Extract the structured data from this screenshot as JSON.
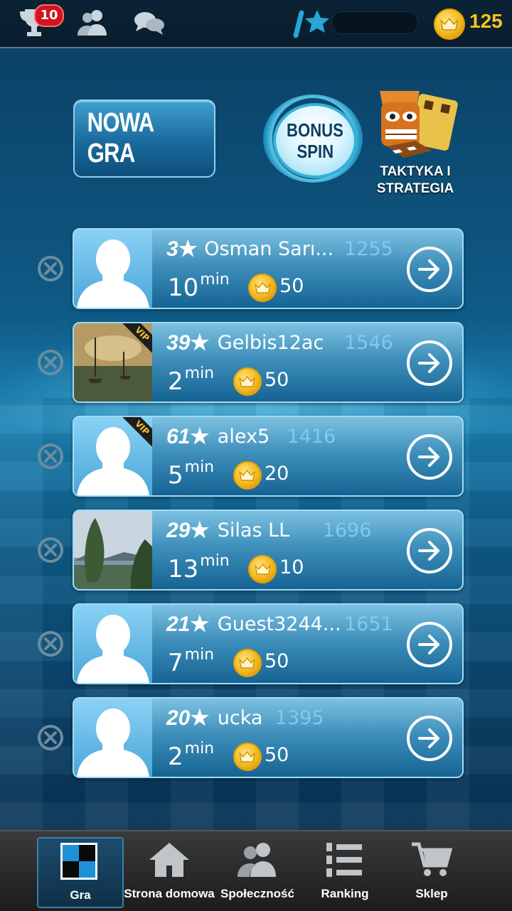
{
  "topbar": {
    "trophy_badge": "10",
    "coins": "125"
  },
  "actions": {
    "new_game": "NOWA GRA",
    "bonus_line1": "BONUS",
    "bonus_line2": "SPIN",
    "tactic_line1": "TAKTYKA I",
    "tactic_line2": "STRATEGIA"
  },
  "games": [
    {
      "level": "3",
      "name": "Osman Sarı...",
      "rating": "1255",
      "time": "10",
      "unit": "min",
      "stake": "50",
      "avatar": "silhouette",
      "vip": false
    },
    {
      "level": "39",
      "name": "Gelbis12ac",
      "rating": "1546",
      "time": "2",
      "unit": "min",
      "stake": "50",
      "avatar": "painting",
      "vip": true
    },
    {
      "level": "61",
      "name": "alex5",
      "rating": "1416",
      "time": "5",
      "unit": "min",
      "stake": "20",
      "avatar": "silhouette",
      "vip": true
    },
    {
      "level": "29",
      "name": "Silas LL",
      "rating": "1696",
      "time": "13",
      "unit": "min",
      "stake": "10",
      "avatar": "landscape",
      "vip": false
    },
    {
      "level": "21",
      "name": "Guest3244...",
      "rating": "1651",
      "time": "7",
      "unit": "min",
      "stake": "50",
      "avatar": "silhouette",
      "vip": false
    },
    {
      "level": "20",
      "name": "ucka",
      "rating": "1395",
      "time": "2",
      "unit": "min",
      "stake": "50",
      "avatar": "silhouette",
      "vip": false
    }
  ],
  "vip_label": "VIP",
  "nav": {
    "game": "Gra",
    "home": "Strona domowa",
    "community": "Społeczność",
    "ranking": "Ranking",
    "shop": "Sklep"
  },
  "colors": {
    "accent": "#2a86b8",
    "coin": "#f3b81d",
    "badge": "#d2141e",
    "rating": "#7fcaf0"
  }
}
